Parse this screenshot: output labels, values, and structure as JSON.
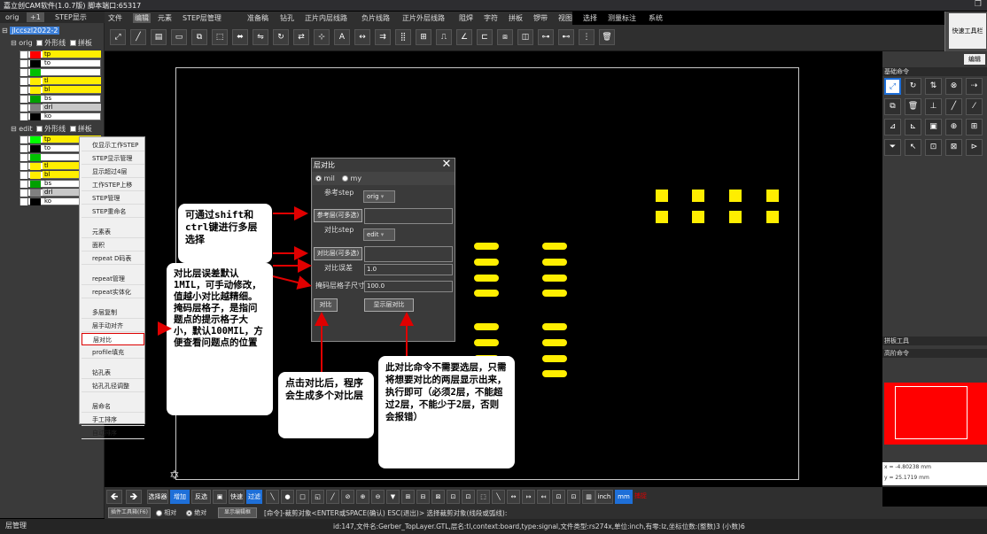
{
  "window": {
    "title": "嘉立创CAM软件(1.0.7版) 脚本端口:65317"
  },
  "left_panel": {
    "tabs": [
      "orig",
      "+1",
      "STEP显示"
    ],
    "job": "jlccszl2022-2",
    "steps": [
      {
        "name": "orig",
        "profile_label": "外形线",
        "panel_label": "拼板",
        "layers": [
          {
            "name": "tp",
            "color": "#ff0000"
          },
          {
            "name": "to",
            "color": "#000000"
          },
          {
            "name": "",
            "color": "#00c000"
          },
          {
            "name": "tl",
            "color": "#ffee00"
          },
          {
            "name": "bl",
            "color": "#ffee00"
          },
          {
            "name": "bs",
            "color": "#00a000"
          },
          {
            "name": "drl",
            "color": "#808080"
          },
          {
            "name": "ko",
            "color": "#000000"
          }
        ]
      },
      {
        "name": "edit",
        "profile_label": "外形线",
        "panel_label": "拼板",
        "layers": [
          {
            "name": "tp",
            "color": "#00ff00"
          },
          {
            "name": "to",
            "color": "#000000"
          },
          {
            "name": "",
            "color": "#00c000"
          },
          {
            "name": "tl",
            "color": "#ffee00"
          },
          {
            "name": "bl",
            "color": "#ffee00"
          },
          {
            "name": "bs",
            "color": "#00a000"
          },
          {
            "name": "drl",
            "color": "#808080"
          },
          {
            "name": "ko",
            "color": "#000000"
          }
        ]
      }
    ]
  },
  "menu": [
    "文件",
    "编辑",
    "元素",
    "STEP层管理",
    "准备稿",
    "钻孔",
    "正片内层线路",
    "负片线路",
    "正片外层线路",
    "阻焊",
    "字符",
    "拼板",
    "锣带",
    "视图",
    "选择",
    "测量标注",
    "系统"
  ],
  "menu_active": "编辑",
  "toolbar_icons": [
    "select-icon",
    "line-icon",
    "drill-icon",
    "box-icon",
    "resize-icon",
    "transform-icon",
    "copy-icon",
    "mirror-icon",
    "rotate-icon",
    "flip-icon",
    "snap-icon",
    "text-icon",
    "measure-icon",
    "align-icon",
    "array-icon",
    "grid-icon",
    "route-icon",
    "angle-icon",
    "offset-icon",
    "merge-icon",
    "clip-icon",
    "join-icon",
    "split-icon",
    "pattern-icon",
    "delete-icon"
  ],
  "quick_toolbar": "快速工具栏",
  "context_menu": {
    "items": [
      "仅显示工作STEP",
      "STEP显示管理",
      "显示超过4层",
      "工作STEP上移",
      "STEP管理",
      "STEP重命名",
      "元素表",
      "面积",
      "repeat D码表",
      "repeat管理",
      "repeat实体化",
      "多层复制",
      "层手动对齐",
      "层对比",
      "profile填充",
      "钻孔表",
      "钻孔孔径调整",
      "层命名",
      "手工排序",
      "自动排序"
    ],
    "highlight": "层对比"
  },
  "dialog": {
    "title": "层对比",
    "unit_mil": "mil",
    "unit_my": "my",
    "ref_step_label": "参考step",
    "ref_step_value": "orig",
    "ref_layer_btn": "参考层(可多选)",
    "cmp_step_label": "对比step",
    "cmp_step_value": "edit",
    "cmp_layer_btn": "对比层(可多选)",
    "tolerance_label": "对比误差",
    "tolerance_value": "1.0",
    "mask_label": "掩码层格子尺寸",
    "mask_value": "100.0",
    "compare_btn": "对比",
    "show_btn": "显示层对比"
  },
  "notes": {
    "n1": "可通过shift和ctrl键进行多层选择",
    "n2": "对比层误差默认1MIL，可手动修改，值越小对比越精细。掩码层格子，是指问题点的提示格子大小，默认100MIL，方便查看问题点的位置",
    "n3": "点击对比后，程序会生成多个对比层",
    "n4": "此对比命令不需要选层，只需将想要对比的两层显示出来，执行即可（必须2层，不能超过2层，不能少于2层，否则会报错）"
  },
  "right_panel": {
    "edit_label": "编辑",
    "basic_title": "基础命令",
    "panel_title": "拼板工具",
    "advanced_title": "高阶命令",
    "coord_x": "x = -4.80238 mm",
    "coord_y": "y = 25.1719 mm"
  },
  "bottom_toolbar": {
    "select_all": "选择器",
    "add": "增加",
    "deselect": "反选",
    "fast": "快速",
    "filter": "过滤",
    "inch": "inch",
    "mm": "mm",
    "snap": "捕捉"
  },
  "cmd_bar": {
    "btn1": "插件工具箱(F6)",
    "rel": "相对",
    "abs": "绝对",
    "show_btn": "显示编辑框",
    "command": "[命令]-裁剪对象<ENTER或SPACE(确认) ESC(退出)> 选择裁剪对象(线段或弧线):"
  },
  "status": {
    "left_tab": "层管理",
    "info": "id:147,文件名:Gerber_TopLayer.GTL,层名:tl,context:board,type:signal,文件类型:rs274x,单位:inch,有零:lz,坐标位数:(整数)3 (小数)6"
  },
  "colors": {
    "accent": "#1e6fd8",
    "pad": "#ffee00",
    "arrow": "#e00000",
    "highlight": "#ff0000"
  }
}
